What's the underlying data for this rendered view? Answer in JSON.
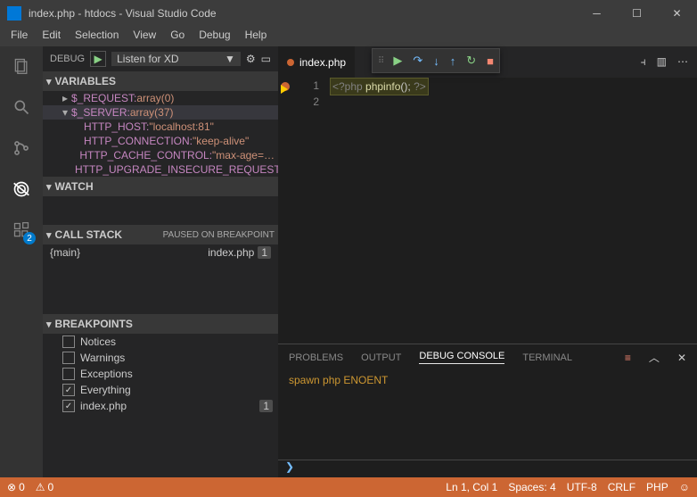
{
  "titlebar": {
    "title": "index.php - htdocs - Visual Studio Code"
  },
  "menubar": [
    "File",
    "Edit",
    "Selection",
    "View",
    "Go",
    "Debug",
    "Help"
  ],
  "activitybar": {
    "badge": "2"
  },
  "debugbar": {
    "label": "DEBUG",
    "config": "Listen for XD",
    "caret": "▼"
  },
  "sections": {
    "variables": "VARIABLES",
    "watch": "WATCH",
    "callstack": "CALL STACK",
    "callstack_state": "PAUSED ON BREAKPOINT",
    "breakpoints": "BREAKPOINTS"
  },
  "variables": [
    {
      "indent": 1,
      "chev": "▸",
      "name": "$_REQUEST: ",
      "val": "array(0)",
      "sel": false
    },
    {
      "indent": 1,
      "chev": "▾",
      "name": "$_SERVER: ",
      "val": "array(37)",
      "sel": true
    },
    {
      "indent": 2,
      "chev": "",
      "name": "HTTP_HOST: ",
      "val": "\"localhost:81\"",
      "sel": false
    },
    {
      "indent": 2,
      "chev": "",
      "name": "HTTP_CONNECTION: ",
      "val": "\"keep-alive\"",
      "sel": false
    },
    {
      "indent": 2,
      "chev": "",
      "name": "HTTP_CACHE_CONTROL: ",
      "val": "\"max-age=…",
      "sel": false
    },
    {
      "indent": 2,
      "chev": "",
      "name": "HTTP_UPGRADE_INSECURE_REQUEST…",
      "val": "",
      "sel": false
    }
  ],
  "callstack": [
    {
      "name": "{main}",
      "file": "index.php",
      "line": "1"
    }
  ],
  "breakpoints": [
    {
      "label": "Notices",
      "on": false
    },
    {
      "label": "Warnings",
      "on": false
    },
    {
      "label": "Exceptions",
      "on": false
    },
    {
      "label": "Everything",
      "on": true
    },
    {
      "label": "index.php",
      "on": true,
      "num": "1"
    }
  ],
  "tab": {
    "name": "index.php"
  },
  "editor": {
    "line1_open": "<?php",
    "line1_fn": " phpinfo",
    "line1_rest": "(); ",
    "line1_close": "?>",
    "ln1": "1",
    "ln2": "2"
  },
  "panel": {
    "tabs": [
      "PROBLEMS",
      "OUTPUT",
      "DEBUG CONSOLE",
      "TERMINAL"
    ],
    "active": 2,
    "output": "spawn php ENOENT",
    "prompt": "❯"
  },
  "status": {
    "errors": "0",
    "warnings": "0",
    "pos": "Ln 1, Col 1",
    "spaces": "Spaces: 4",
    "enc": "UTF-8",
    "eol": "CRLF",
    "lang": "PHP",
    "smile": "☺"
  }
}
